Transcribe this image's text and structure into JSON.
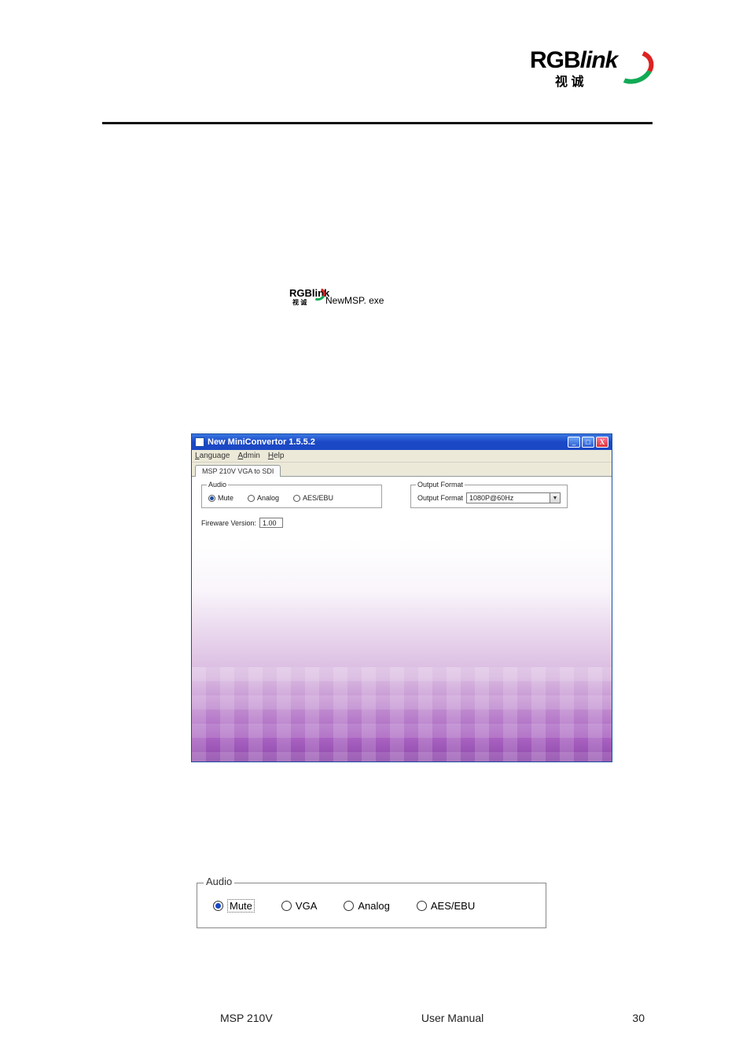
{
  "header": {
    "brand_left": "RGB",
    "brand_right": "link",
    "brand_cn": "视 诚"
  },
  "exe": {
    "filename": "NewMSP. exe"
  },
  "window": {
    "title": "New MiniConvertor 1.5.5.2",
    "menu": {
      "language": "Language",
      "admin": "Admin",
      "help": "Help"
    },
    "tab": "MSP 210V VGA to SDI",
    "audio": {
      "legend": "Audio",
      "mute": "Mute",
      "analog": "Analog",
      "aesebu": "AES/EBU",
      "selected": "mute"
    },
    "output": {
      "legend": "Output Format",
      "label": "Output Format",
      "value": "1080P@60Hz"
    },
    "firmware": {
      "label": "Fireware Version:",
      "value": "1.00"
    },
    "buttons": {
      "min": "_",
      "max": "□",
      "close": "X"
    }
  },
  "zoom_audio": {
    "legend": "Audio",
    "mute": "Mute",
    "vga": "VGA",
    "analog": "Analog",
    "aesebu": "AES/EBU"
  },
  "footer": {
    "model": "MSP 210V",
    "doc": "User Manual",
    "page": "30"
  }
}
